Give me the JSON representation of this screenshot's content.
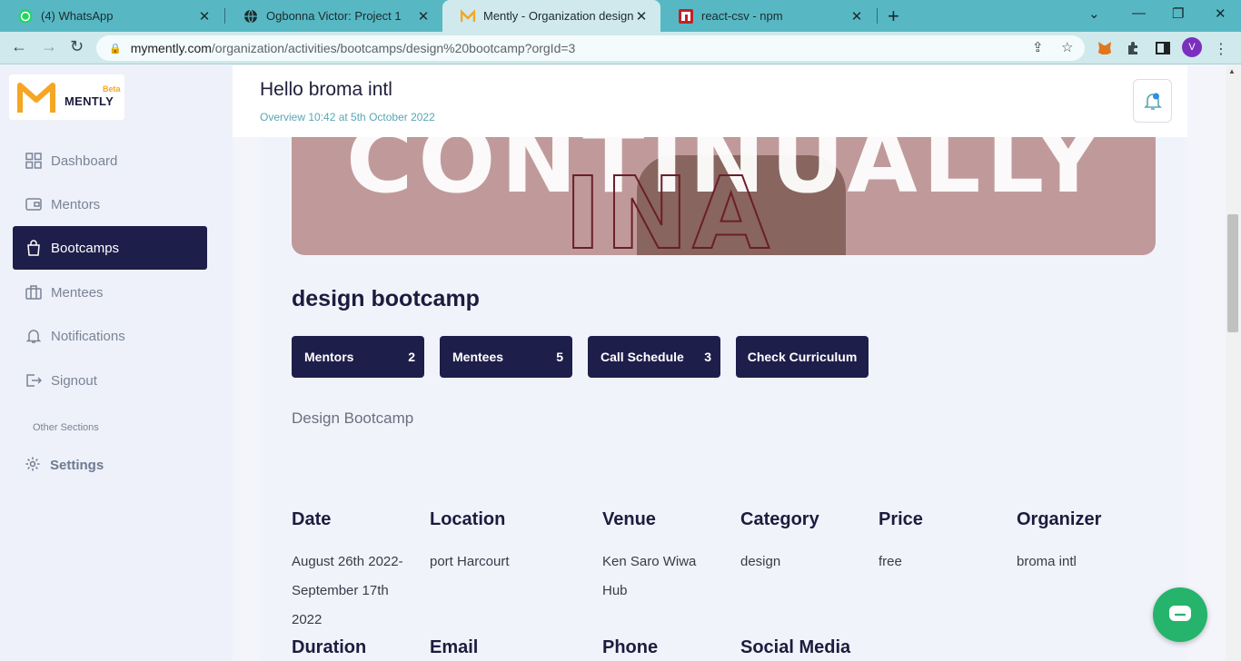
{
  "browser": {
    "tabs": [
      {
        "title": "(4) WhatsApp",
        "icon": "whatsapp-icon"
      },
      {
        "title": "Ogbonna Victor: Project 1",
        "icon": "globe-icon"
      },
      {
        "title": "Mently - Organization design bo",
        "icon": "mently-icon"
      },
      {
        "title": "react-csv - npm",
        "icon": "npm-icon"
      }
    ],
    "new_tab_label": "+",
    "url_host": "mymently.com",
    "url_path": "/organization/activities/bootcamps/design%20bootcamp?orgId=3",
    "profile_initial": "V"
  },
  "brand": {
    "name": "MENTLY",
    "badge": "Beta",
    "accent": "#f5a623"
  },
  "sidebar": {
    "items": [
      {
        "label": "Dashboard",
        "icon": "dashboard-icon",
        "active": false
      },
      {
        "label": "Mentors",
        "icon": "wallet-icon",
        "active": false
      },
      {
        "label": "Bootcamps",
        "icon": "shopping-bag-icon",
        "active": true
      },
      {
        "label": "Mentees",
        "icon": "briefcase-icon",
        "active": false
      },
      {
        "label": "Notifications",
        "icon": "bell-icon",
        "active": false
      },
      {
        "label": "Signout",
        "icon": "signout-icon",
        "active": false
      }
    ],
    "other_sections_label": "Other Sections",
    "settings_label": "Settings"
  },
  "header": {
    "greeting": "Hello broma intl",
    "overview": "Overview 10:42 at 5th October 2022"
  },
  "banner": {
    "word": "CONTINUALLY"
  },
  "bootcamp": {
    "title": "design bootcamp",
    "buttons": [
      {
        "label": "Mentors",
        "count": "2"
      },
      {
        "label": "Mentees",
        "count": "5"
      },
      {
        "label": "Call Schedule",
        "count": "3"
      },
      {
        "label": "Check Curriculum",
        "count": ""
      }
    ],
    "description": "Design Bootcamp",
    "details": [
      {
        "heading": "Date",
        "value": "August 26th 2022-September 17th 2022"
      },
      {
        "heading": "Location",
        "value": "port Harcourt"
      },
      {
        "heading": "Venue",
        "value": "Ken Saro Wiwa Hub"
      },
      {
        "heading": "Category",
        "value": "design"
      },
      {
        "heading": "Price",
        "value": "free"
      },
      {
        "heading": "Organizer",
        "value": "broma intl"
      }
    ],
    "details_row2": [
      {
        "heading": "Duration"
      },
      {
        "heading": "Email"
      },
      {
        "heading": "Phone"
      },
      {
        "heading": "Social Media"
      }
    ]
  },
  "colors": {
    "primary": "#1e1e4b",
    "tabbar": "#57b8c4",
    "chat": "#26b36b"
  }
}
